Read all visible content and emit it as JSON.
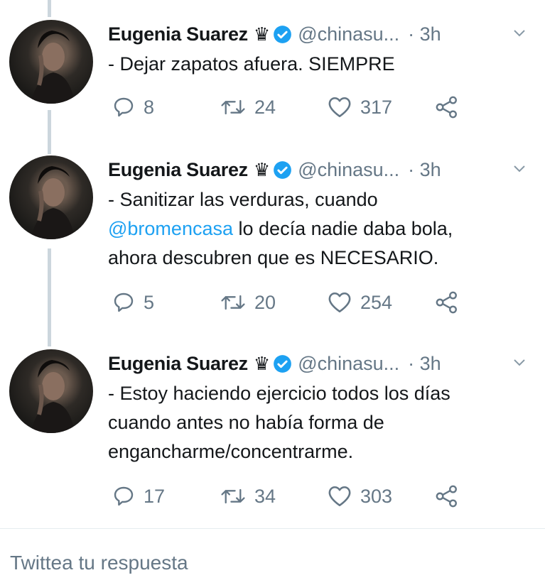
{
  "tweets": [
    {
      "author": "Eugenia Suarez",
      "badge_icon": "crown-icon",
      "handle": "@chinasu...",
      "time": "· 3h",
      "text_parts": [
        "- Dejar zapatos afuera. SIEMPRE"
      ],
      "mention": "",
      "replies": "8",
      "retweets": "24",
      "likes": "317"
    },
    {
      "author": "Eugenia Suarez",
      "badge_icon": "crown-icon",
      "handle": "@chinasu...",
      "time": "· 3h",
      "text_parts": [
        "- Sanitizar las verduras, cuando",
        "lo decía nadie daba bola,",
        "ahora descubren que es NECESARIO."
      ],
      "mention": "@bromencasa",
      "replies": "5",
      "retweets": "20",
      "likes": "254"
    },
    {
      "author": "Eugenia Suarez",
      "badge_icon": "crown-icon",
      "handle": "@chinasu...",
      "time": "· 3h",
      "text_parts": [
        "- Estoy haciendo ejercicio todos los días",
        "cuando antes no había forma de",
        "engancharme/concentrarme."
      ],
      "mention": "",
      "replies": "17",
      "retweets": "34",
      "likes": "303"
    }
  ],
  "reply_box": {
    "placeholder": "Twittea tu respuesta"
  },
  "colors": {
    "accent": "#1da1f2",
    "muted": "#657786",
    "thread": "#ccd6dd",
    "verified": "#1da1f2"
  }
}
